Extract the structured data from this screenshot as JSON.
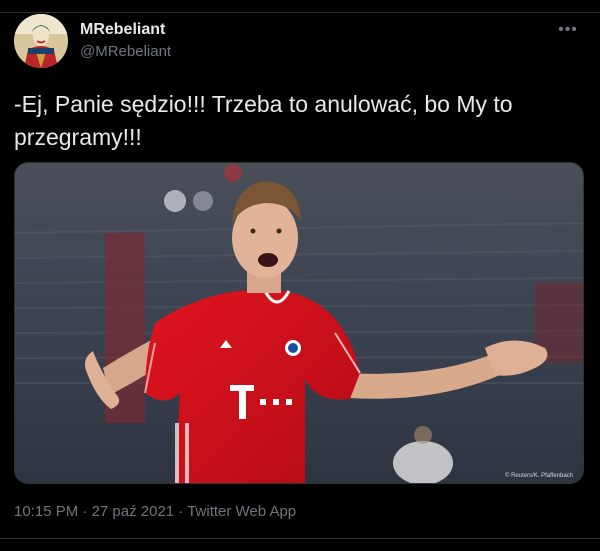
{
  "tweet": {
    "author": {
      "display_name": "MRebeliant",
      "handle": "@MRebeliant"
    },
    "more_icon": "more-horizontal-icon",
    "text": "-Ej, Panie sędzio!!! Trzeba to anulować, bo My to przegramy!!!",
    "media": {
      "credit": "© Reuters/K. Pfaffenbach",
      "description_icon": "photo"
    },
    "meta": {
      "time": "10:15 PM",
      "separator": " · ",
      "date": "27 paź 2021",
      "source": "Twitter Web App"
    }
  },
  "colors": {
    "background": "#000000",
    "text": "#e7e9ea",
    "secondary": "#71767b",
    "border": "#2f3336",
    "jersey_red": "#d6131f"
  }
}
